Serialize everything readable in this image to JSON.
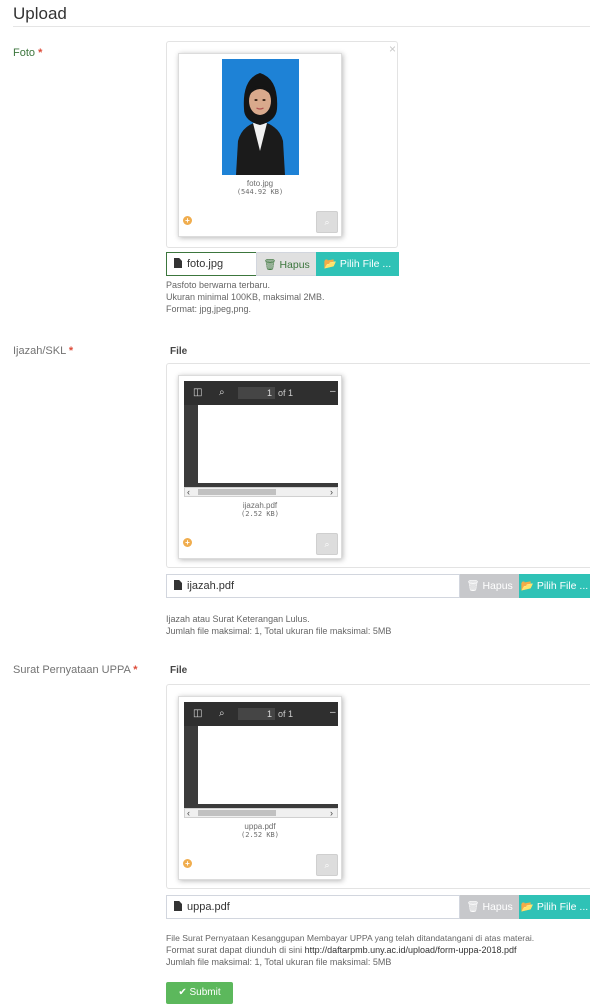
{
  "section": {
    "title": "Upload"
  },
  "foto": {
    "label": "Foto",
    "required": "*",
    "close": "×",
    "thumb_name": "foto.jpg",
    "thumb_size": "(544.92 KB)",
    "caption": "foto.jpg",
    "remove_label": "Hapus",
    "browse_label": "Pilih File ...",
    "help": [
      "Pasfoto berwarna terbaru.",
      "Ukuran minimal 100KB, maksimal 2MB.",
      "Format: jpg,jpeg,png."
    ]
  },
  "ijazah": {
    "label": "Ijazah/SKL",
    "required": "*",
    "heading": "File",
    "page_number": "1",
    "page_of": "of 1",
    "thumb_name": "ijazah.pdf",
    "thumb_size": "(2.52 KB)",
    "caption": "ijazah.pdf",
    "remove_label": "Hapus",
    "browse_label": "Pilih File ...",
    "help": [
      "Ijazah atau Surat Keterangan Lulus.",
      "Jumlah file maksimal: 1, Total ukuran file maksimal: 5MB"
    ]
  },
  "uppa": {
    "label": "Surat Pernyataan UPPA",
    "required": "*",
    "heading": "File",
    "page_number": "1",
    "page_of": "of 1",
    "thumb_name": "uppa.pdf",
    "thumb_size": "(2.52 KB)",
    "caption": "uppa.pdf",
    "remove_label": "Hapus",
    "browse_label": "Pilih File ...",
    "help_line1": "File Surat Pernyataan Kesanggupan Membayar UPPA yang telah ditandatangani di atas materai.",
    "help_line2_prefix": "Format surat dapat diunduh di sini ",
    "help_line2_link": "http://daftarpmb.uny.ac.id/upload/form-uppa-2018.pdf",
    "help_line3": "Jumlah file maksimal: 1, Total ukuran file maksimal: 5MB"
  },
  "submit": {
    "label": "Submit"
  },
  "colors": {
    "brand_green": "#5cb85c",
    "label_green": "#3c763d",
    "required_red": "#dd4b39",
    "browse_teal": "#2fc2b6",
    "remove_grey": "#c7c8cb",
    "photo_blue": "#1e82d6"
  },
  "icons": {
    "file": "file-icon",
    "trash": "trash-icon",
    "folder_open": "folder-open-icon",
    "zoom": "zoom-icon",
    "plus_circle": "plus-circle-icon",
    "check": "check-icon"
  }
}
